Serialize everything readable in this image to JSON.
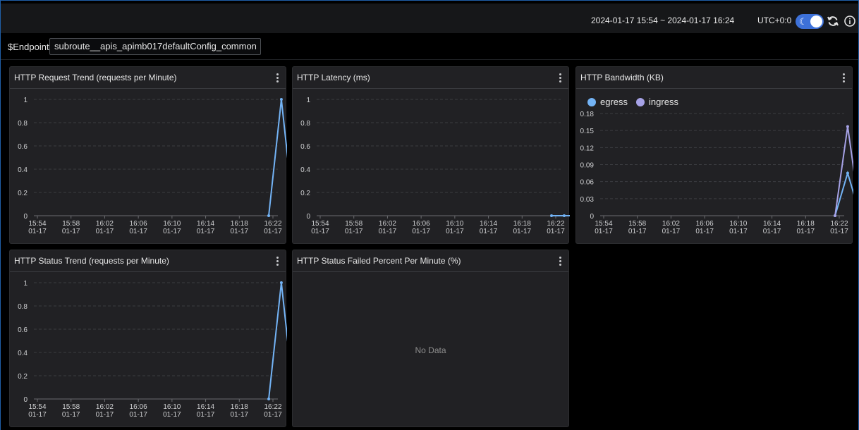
{
  "header": {
    "time_range": "2024-01-17 15:54 ~ 2024-01-17 16:24",
    "timezone": "UTC+0:0"
  },
  "variables": {
    "endpoint_label": "$Endpoint",
    "endpoint_value": "subroute__apis_apimb017defaultConfig_common"
  },
  "icons": {
    "theme": "moon-icon",
    "refresh": "refresh-icon",
    "info": "info-icon"
  },
  "colors": {
    "egress": "#73b3f5",
    "ingress": "#a6a2e6"
  },
  "panels": [
    {
      "title": "HTTP Request Trend (requests per Minute)",
      "chart_data": {
        "type": "line",
        "x_ticks": [
          [
            "15:54",
            "01-17"
          ],
          [
            "15:58",
            "01-17"
          ],
          [
            "16:02",
            "01-17"
          ],
          [
            "16:06",
            "01-17"
          ],
          [
            "16:10",
            "01-17"
          ],
          [
            "16:14",
            "01-17"
          ],
          [
            "16:18",
            "01-17"
          ],
          [
            "16:22",
            "01-17"
          ]
        ],
        "y_ticks": [
          "0",
          "0.2",
          "0.4",
          "0.6",
          "0.8",
          "1"
        ],
        "ylim": [
          0,
          1
        ],
        "series": [
          {
            "color": "#73b3f5",
            "points": [
              [
                27.5,
                0
              ],
              [
                29,
                1
              ],
              [
                30.5,
                0
              ]
            ]
          }
        ]
      }
    },
    {
      "title": "HTTP Latency (ms)",
      "chart_data": {
        "type": "line",
        "x_ticks": [
          [
            "15:54",
            "01-17"
          ],
          [
            "15:58",
            "01-17"
          ],
          [
            "16:02",
            "01-17"
          ],
          [
            "16:06",
            "01-17"
          ],
          [
            "16:10",
            "01-17"
          ],
          [
            "16:14",
            "01-17"
          ],
          [
            "16:18",
            "01-17"
          ],
          [
            "16:22",
            "01-17"
          ]
        ],
        "y_ticks": [
          "0",
          "0.2",
          "0.4",
          "0.6",
          "0.8",
          "1"
        ],
        "ylim": [
          0,
          1
        ],
        "series": [
          {
            "color": "#73b3f5",
            "points": [
              [
                27.5,
                0
              ],
              [
                29,
                0
              ],
              [
                30.5,
                0
              ]
            ]
          }
        ]
      }
    },
    {
      "title": "HTTP Bandwidth (KB)",
      "legend": [
        {
          "name": "egress",
          "color": "#73b3f5"
        },
        {
          "name": "ingress",
          "color": "#a6a2e6"
        }
      ],
      "chart_data": {
        "type": "line",
        "x_ticks": [
          [
            "15:54",
            "01-17"
          ],
          [
            "15:58",
            "01-17"
          ],
          [
            "16:02",
            "01-17"
          ],
          [
            "16:06",
            "01-17"
          ],
          [
            "16:10",
            "01-17"
          ],
          [
            "16:14",
            "01-17"
          ],
          [
            "16:18",
            "01-17"
          ],
          [
            "16:22",
            "01-17"
          ]
        ],
        "y_ticks": [
          "0",
          "0.03",
          "0.06",
          "0.09",
          "0.12",
          "0.15",
          "0.18"
        ],
        "ylim": [
          0,
          0.18
        ],
        "series": [
          {
            "name": "egress",
            "color": "#73b3f5",
            "points": [
              [
                27.5,
                0
              ],
              [
                29,
                0.075
              ],
              [
                30.5,
                0
              ]
            ]
          },
          {
            "name": "ingress",
            "color": "#a6a2e6",
            "points": [
              [
                27.5,
                0
              ],
              [
                29,
                0.157
              ],
              [
                30.5,
                0
              ]
            ]
          }
        ]
      }
    },
    {
      "title": "HTTP Status Trend (requests per Minute)",
      "chart_data": {
        "type": "line",
        "x_ticks": [
          [
            "15:54",
            "01-17"
          ],
          [
            "15:58",
            "01-17"
          ],
          [
            "16:02",
            "01-17"
          ],
          [
            "16:06",
            "01-17"
          ],
          [
            "16:10",
            "01-17"
          ],
          [
            "16:14",
            "01-17"
          ],
          [
            "16:18",
            "01-17"
          ],
          [
            "16:22",
            "01-17"
          ]
        ],
        "y_ticks": [
          "0",
          "0.2",
          "0.4",
          "0.6",
          "0.8",
          "1"
        ],
        "ylim": [
          0,
          1
        ],
        "series": [
          {
            "color": "#73b3f5",
            "points": [
              [
                27.5,
                0
              ],
              [
                29,
                1
              ],
              [
                30.5,
                0
              ]
            ]
          }
        ]
      }
    },
    {
      "title": "HTTP Status Failed Percent Per Minute (%)",
      "no_data": "No Data"
    }
  ]
}
